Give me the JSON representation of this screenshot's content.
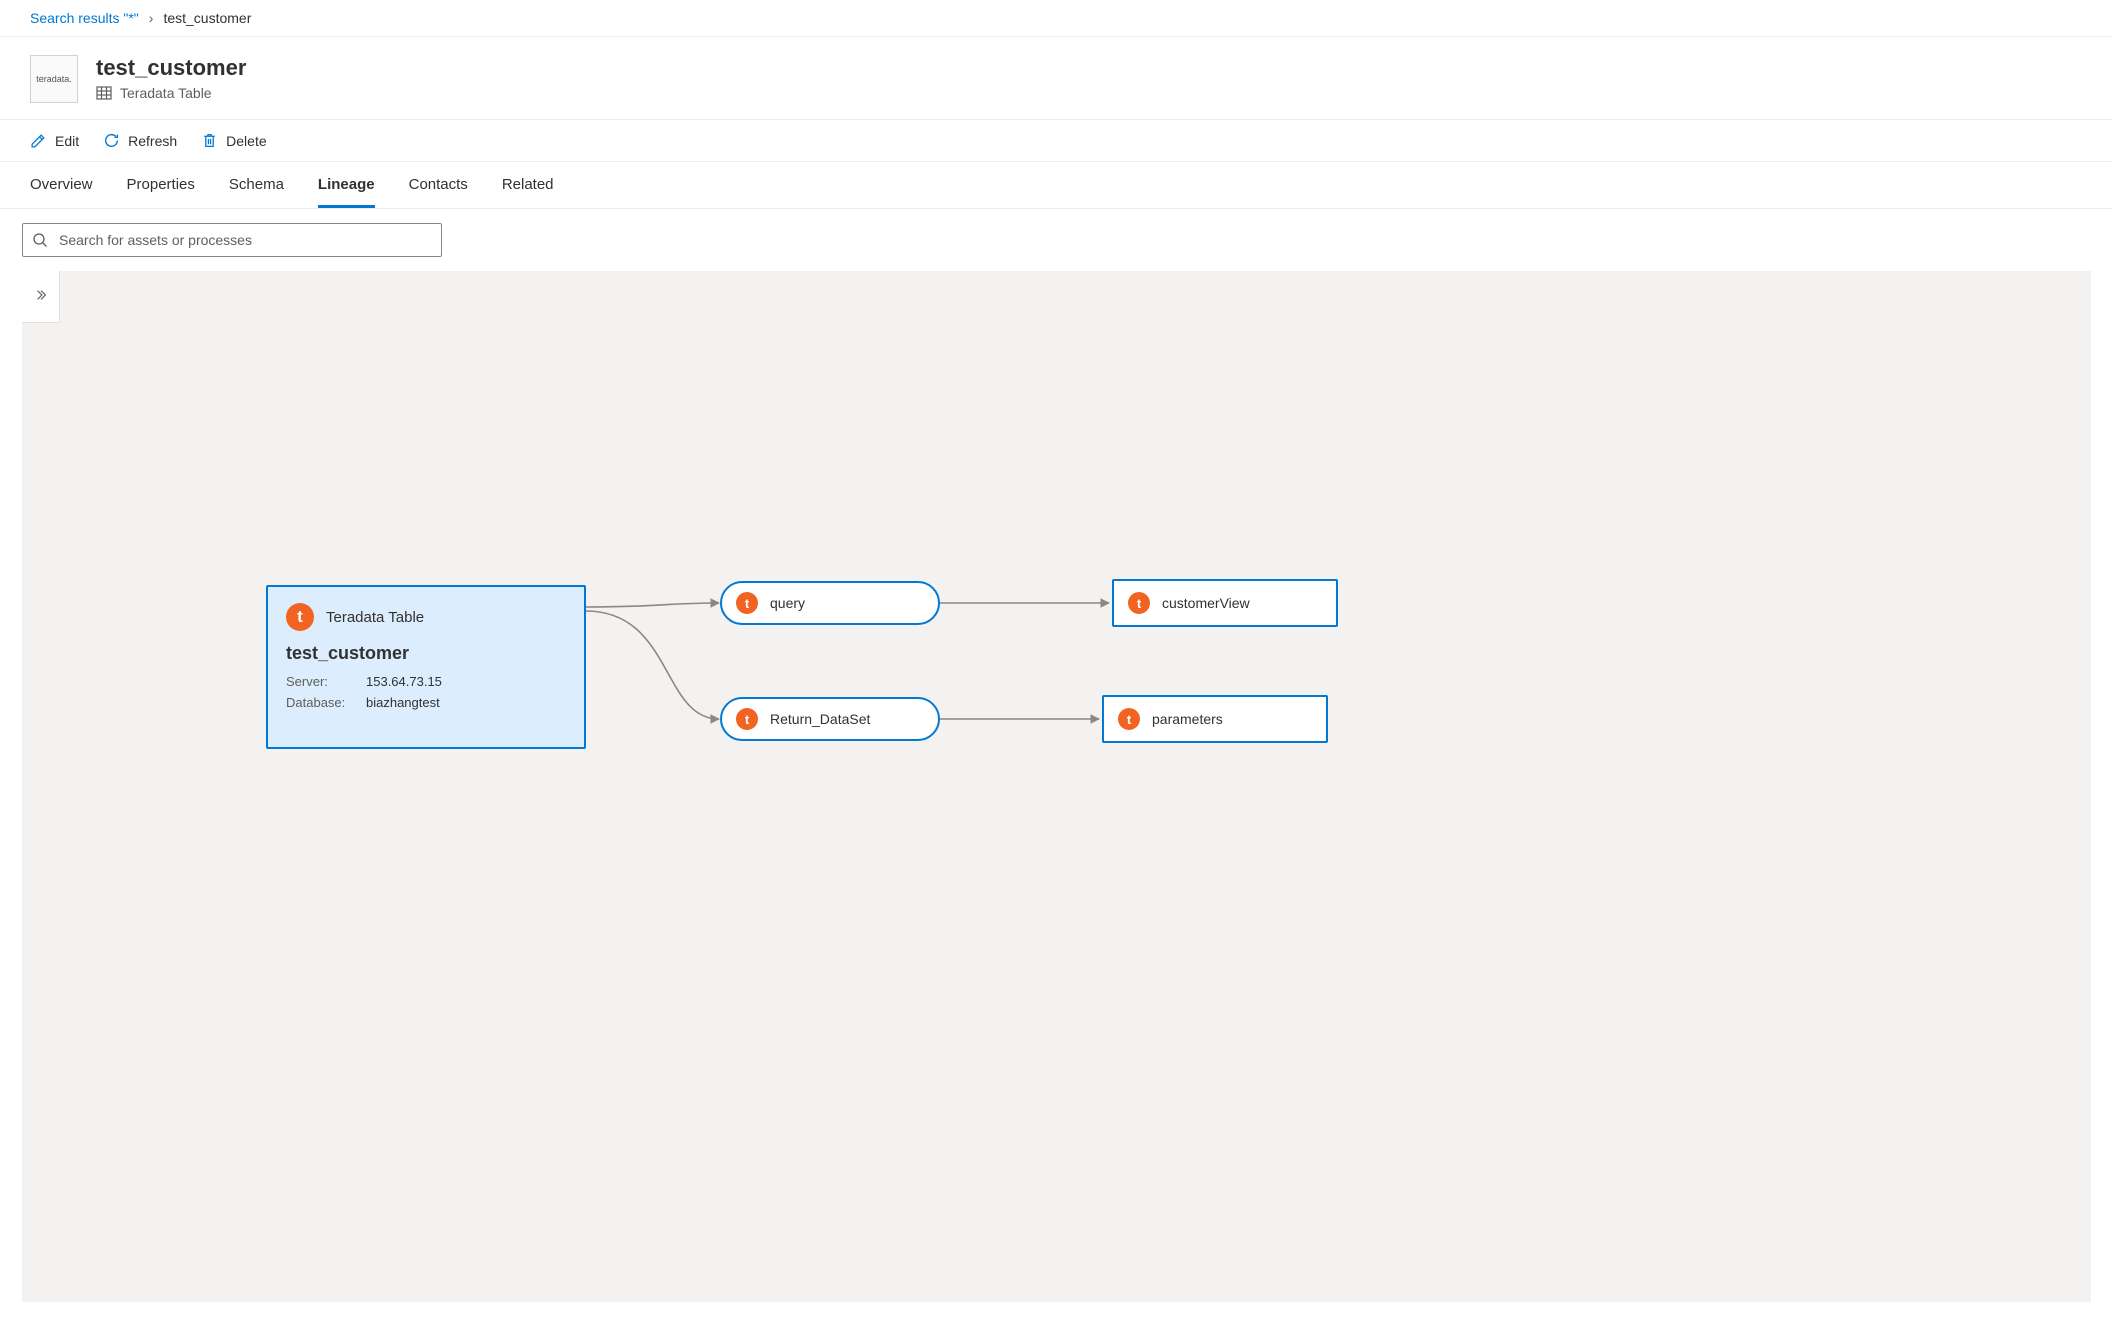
{
  "breadcrumb": {
    "root_link": "Search results \"*\"",
    "current": "test_customer"
  },
  "header": {
    "brand": "teradata.",
    "title": "test_customer",
    "subtitle": "Teradata Table"
  },
  "toolbar": {
    "edit": "Edit",
    "refresh": "Refresh",
    "delete": "Delete"
  },
  "tabs": {
    "overview": "Overview",
    "properties": "Properties",
    "schema": "Schema",
    "lineage": "Lineage",
    "contacts": "Contacts",
    "related": "Related",
    "active": "lineage"
  },
  "search": {
    "placeholder": "Search for assets or processes"
  },
  "lineage": {
    "selected": {
      "type_label": "Teradata Table",
      "name": "test_customer",
      "server_label": "Server:",
      "server_value": "153.64.73.15",
      "database_label": "Database:",
      "database_value": "biazhangtest"
    },
    "processes": [
      {
        "id": "query",
        "label": "query"
      },
      {
        "id": "return_dataset",
        "label": "Return_DataSet"
      }
    ],
    "outputs": [
      {
        "id": "customerView",
        "label": "customerView"
      },
      {
        "id": "parameters",
        "label": "parameters"
      }
    ]
  }
}
